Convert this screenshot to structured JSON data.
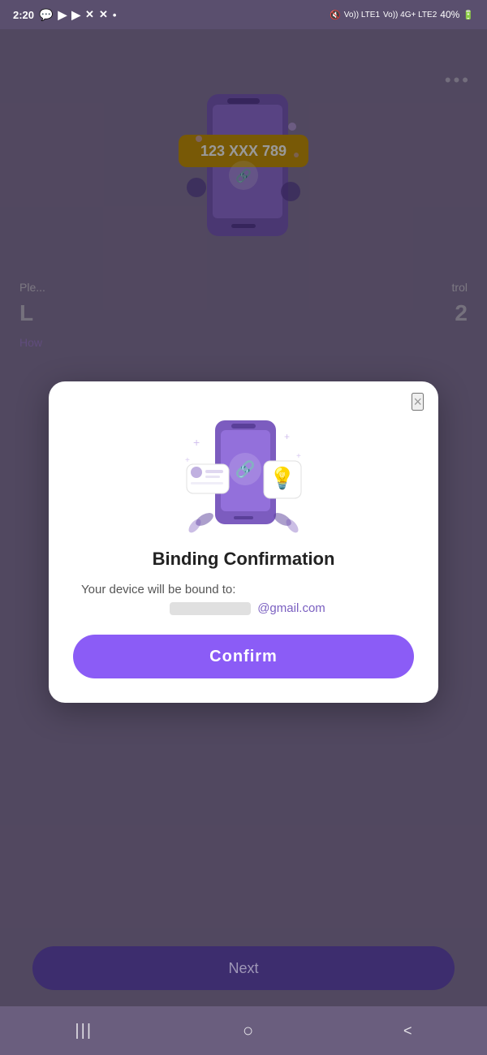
{
  "statusBar": {
    "time": "2:20",
    "battery": "40%",
    "icons": [
      "📱",
      "▶",
      "▶",
      "✕",
      "✕",
      "•"
    ]
  },
  "header": {
    "moreMenuLabel": "•••"
  },
  "bgContent": {
    "phoneNumber": "123 XXX 789",
    "line1": "Ple...",
    "line1_right": "trol",
    "line2_left": "L",
    "line2_right": "2",
    "linkText": "How"
  },
  "nextButton": {
    "label": "Next"
  },
  "bottomNav": {
    "icons": [
      "|||",
      "○",
      "<"
    ]
  },
  "modal": {
    "closeLabel": "×",
    "title": "Binding Confirmation",
    "bodyText": "Your device will be bound to:",
    "emailBlurred": "██████████",
    "emailSuffix": "@gmail.com",
    "confirmLabel": "Confirm"
  }
}
